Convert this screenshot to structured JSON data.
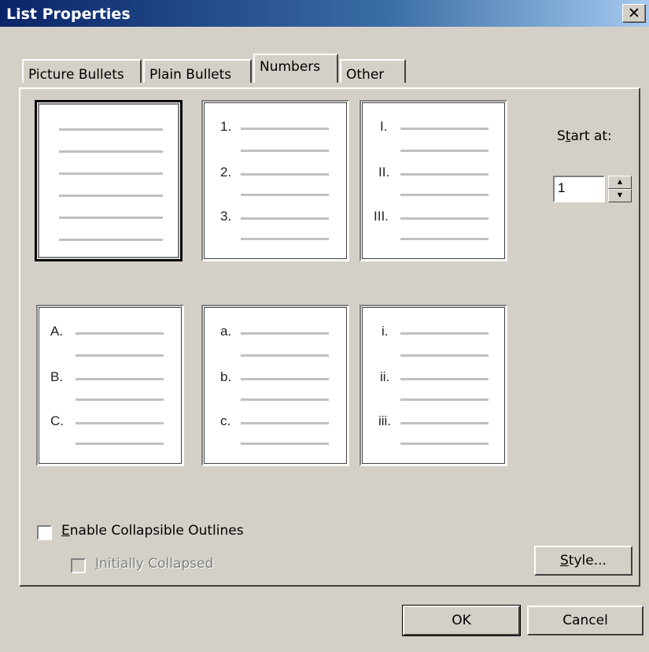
{
  "window": {
    "title": "List Properties",
    "close_glyph": "✕"
  },
  "tabs": [
    {
      "label": "Picture Bullets"
    },
    {
      "label": "Plain Bullets"
    },
    {
      "label": "Numbers",
      "active": true
    },
    {
      "label": "Other"
    }
  ],
  "styles": [
    {
      "name": "None",
      "markers": []
    },
    {
      "name": "Numbers",
      "markers": [
        "1.",
        "2.",
        "3."
      ]
    },
    {
      "name": "Upper Roman",
      "markers": [
        "I.",
        "II.",
        "III."
      ]
    },
    {
      "name": "Upper Alpha",
      "markers": [
        "A.",
        "B.",
        "C."
      ]
    },
    {
      "name": "Lower Alpha",
      "markers": [
        "a.",
        "b.",
        "c."
      ]
    },
    {
      "name": "Lower Roman",
      "markers": [
        "i.",
        "ii.",
        "iii."
      ]
    }
  ],
  "start_at": {
    "label_pre": "S",
    "label_u": "t",
    "label_post": "art at:",
    "value": "1"
  },
  "enable_collapsible": {
    "label_u": "E",
    "label_post": "nable Collapsible Outlines",
    "checked": false
  },
  "initially_collapsed": {
    "label_u": "I",
    "label_post": "nitially Collapsed",
    "checked": false,
    "disabled": true
  },
  "buttons": {
    "style_u": "S",
    "style_post": "tyle...",
    "ok": "OK",
    "cancel": "Cancel"
  }
}
